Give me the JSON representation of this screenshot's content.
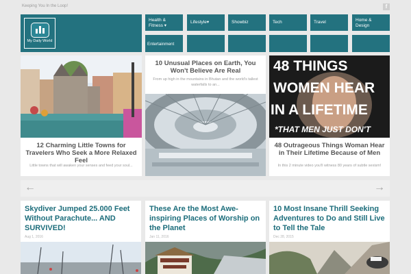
{
  "header": {
    "tagline": "Keeping You In the Loop!",
    "facebook_icon_label": "f",
    "logo_text": "My Daily World",
    "logo_icon": "chart-bars-icon"
  },
  "nav": [
    {
      "label": "Health &\nFitness ▾"
    },
    {
      "label": "Lifestyle▾"
    },
    {
      "label": "Showbiz"
    },
    {
      "label": "Tech"
    },
    {
      "label": "Travel"
    },
    {
      "label": "Home &\nDesign"
    },
    {
      "label": "Entertainment"
    }
  ],
  "featured": [
    {
      "title": "12 Charming Little Towns for Travelers Who Seek a More Relaxed Feel",
      "desc": "Little towns that will awaken your senses and feed your soul..."
    },
    {
      "title": "10 Unusual Places on Earth, You Won't Believe Are Real",
      "desc": "From up high in the mountains in Bhutan and the world's tallest waterfalls to an..."
    },
    {
      "title": "48 Outrageous Things Woman Hear in Their Lifetime Because of Men",
      "desc": "In this 2 minute video you'll witness 80 years of subtle sexism!",
      "image_text": {
        "line1": "48 THINGS",
        "line2": "WOMEN HEAR",
        "line3": "IN A LIFETIME",
        "line4": "*THAT MEN JUST DON'T"
      }
    }
  ],
  "slider": {
    "prev_icon": "arrow-left-icon",
    "next_icon": "arrow-right-icon",
    "prev": "←",
    "next": "→"
  },
  "posts": [
    {
      "title": "Skydiver Jumped 25.000 Feet Without Parachute... AND SURVIVED!",
      "date": "Aug 1, 2016"
    },
    {
      "title": "These Are the Most Awe-inspiring Places of Worship on the Planet",
      "date": "Jan 11, 2016"
    },
    {
      "title": "10 Most Insane Thrill Seeking Adventures to Do and Still Live to Tell the Tale",
      "date": "Dec 28, 2015"
    }
  ],
  "colors": {
    "brand": "#23727f",
    "post_title": "#1c6d7b"
  }
}
